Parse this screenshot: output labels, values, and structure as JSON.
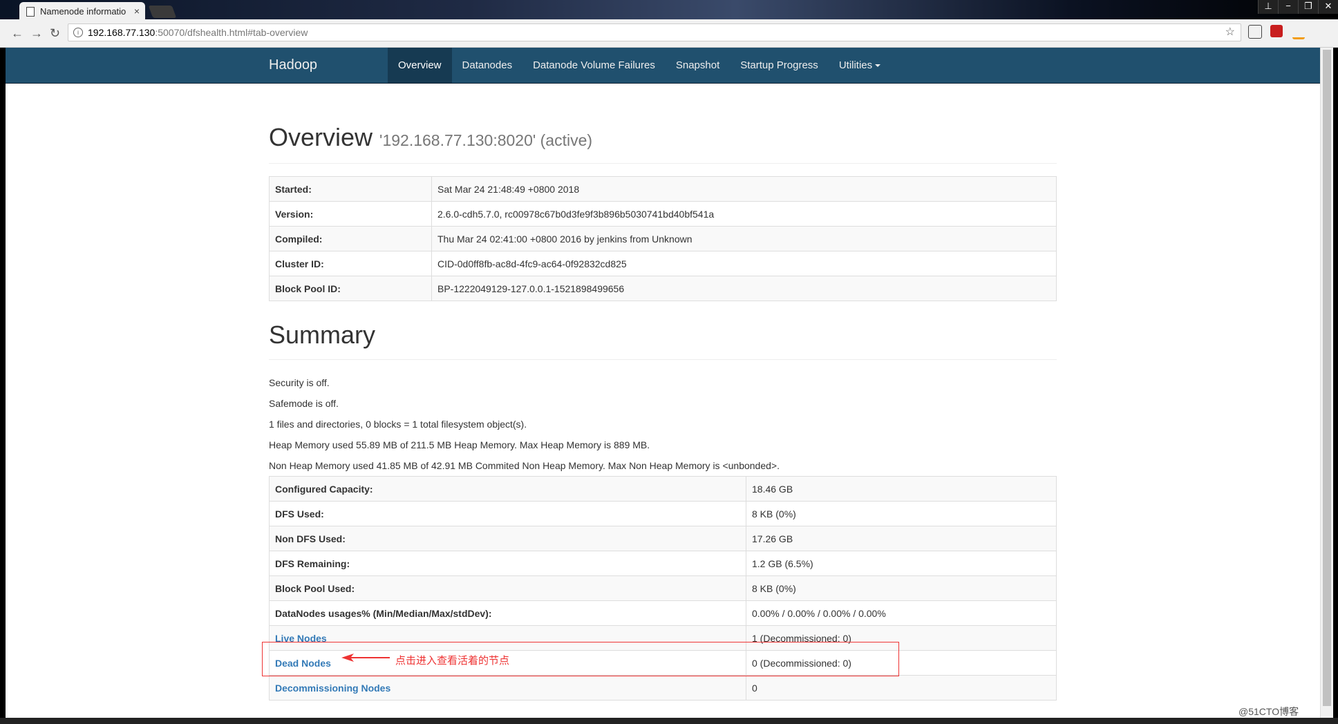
{
  "browser": {
    "tab_title": "Namenode informatio",
    "tab_close": "×",
    "url_host": "192.168.77.130",
    "url_path": ":50070/dfshealth.html#tab-overview",
    "url_info": "i",
    "star": "☆",
    "back": "←",
    "forward": "→",
    "reload": "↻",
    "win_ctrls": [
      "⊥",
      "−",
      "❐",
      "✕"
    ]
  },
  "navbar": {
    "brand": "Hadoop",
    "items": [
      {
        "label": "Overview",
        "active": true
      },
      {
        "label": "Datanodes"
      },
      {
        "label": "Datanode Volume Failures"
      },
      {
        "label": "Snapshot"
      },
      {
        "label": "Startup Progress"
      },
      {
        "label": "Utilities"
      }
    ]
  },
  "overview": {
    "title": "Overview",
    "subtitle": "'192.168.77.130:8020' (active)",
    "rows": [
      {
        "key": "Started:",
        "value": "Sat Mar 24 21:48:49 +0800 2018"
      },
      {
        "key": "Version:",
        "value": "2.6.0-cdh5.7.0, rc00978c67b0d3fe9f3b896b5030741bd40bf541a"
      },
      {
        "key": "Compiled:",
        "value": "Thu Mar 24 02:41:00 +0800 2016 by jenkins from Unknown"
      },
      {
        "key": "Cluster ID:",
        "value": "CID-0d0ff8fb-ac8d-4fc9-ac64-0f92832cd825"
      },
      {
        "key": "Block Pool ID:",
        "value": "BP-1222049129-127.0.0.1-1521898499656"
      }
    ]
  },
  "summary": {
    "title": "Summary",
    "lines": [
      "Security is off.",
      "Safemode is off.",
      "1 files and directories, 0 blocks = 1 total filesystem object(s).",
      "Heap Memory used 55.89 MB of 211.5 MB Heap Memory. Max Heap Memory is 889 MB.",
      "Non Heap Memory used 41.85 MB of 42.91 MB Commited Non Heap Memory. Max Non Heap Memory is <unbonded>."
    ],
    "rows": [
      {
        "key": "Configured Capacity:",
        "value": "18.46 GB"
      },
      {
        "key": "DFS Used:",
        "value": "8 KB (0%)"
      },
      {
        "key": "Non DFS Used:",
        "value": "17.26 GB"
      },
      {
        "key": "DFS Remaining:",
        "value": "1.2 GB (6.5%)"
      },
      {
        "key": "Block Pool Used:",
        "value": "8 KB (0%)"
      },
      {
        "key": "DataNodes usages% (Min/Median/Max/stdDev):",
        "value": "0.00% / 0.00% / 0.00% / 0.00%"
      },
      {
        "key": "Live Nodes",
        "value": "1 (Decommissioned: 0)",
        "link": true
      },
      {
        "key": "Dead Nodes",
        "value": "0 (Decommissioned: 0)",
        "link": true
      },
      {
        "key": "Decommissioning Nodes",
        "value": "0",
        "link": true
      }
    ]
  },
  "annotation": {
    "text": "点击进入查看活着的节点",
    "color": "#e33333"
  },
  "watermark": "@51CTO博客"
}
